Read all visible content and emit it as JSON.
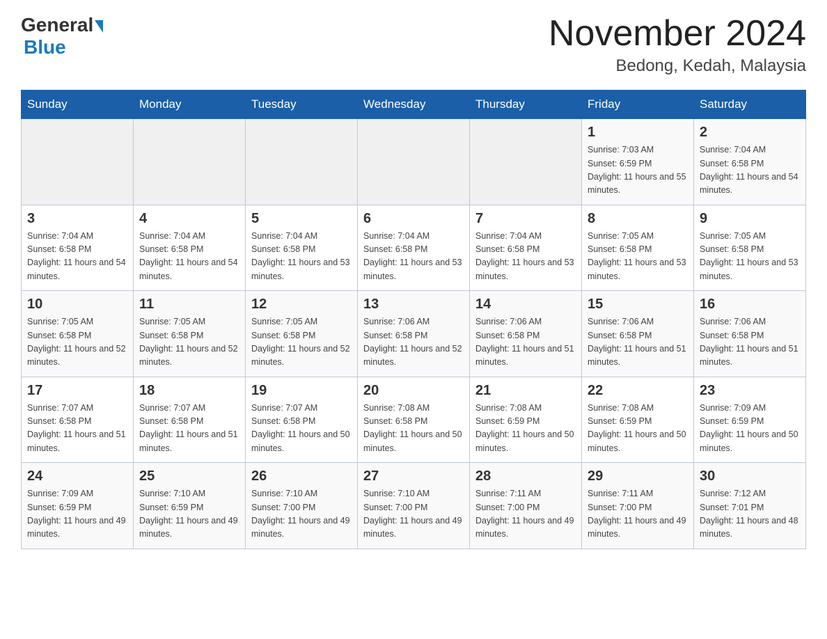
{
  "logo": {
    "general": "General",
    "blue": "Blue"
  },
  "header": {
    "month": "November 2024",
    "location": "Bedong, Kedah, Malaysia"
  },
  "days_of_week": [
    "Sunday",
    "Monday",
    "Tuesday",
    "Wednesday",
    "Thursday",
    "Friday",
    "Saturday"
  ],
  "weeks": [
    [
      {
        "day": "",
        "info": ""
      },
      {
        "day": "",
        "info": ""
      },
      {
        "day": "",
        "info": ""
      },
      {
        "day": "",
        "info": ""
      },
      {
        "day": "",
        "info": ""
      },
      {
        "day": "1",
        "info": "Sunrise: 7:03 AM\nSunset: 6:59 PM\nDaylight: 11 hours and 55 minutes."
      },
      {
        "day": "2",
        "info": "Sunrise: 7:04 AM\nSunset: 6:58 PM\nDaylight: 11 hours and 54 minutes."
      }
    ],
    [
      {
        "day": "3",
        "info": "Sunrise: 7:04 AM\nSunset: 6:58 PM\nDaylight: 11 hours and 54 minutes."
      },
      {
        "day": "4",
        "info": "Sunrise: 7:04 AM\nSunset: 6:58 PM\nDaylight: 11 hours and 54 minutes."
      },
      {
        "day": "5",
        "info": "Sunrise: 7:04 AM\nSunset: 6:58 PM\nDaylight: 11 hours and 53 minutes."
      },
      {
        "day": "6",
        "info": "Sunrise: 7:04 AM\nSunset: 6:58 PM\nDaylight: 11 hours and 53 minutes."
      },
      {
        "day": "7",
        "info": "Sunrise: 7:04 AM\nSunset: 6:58 PM\nDaylight: 11 hours and 53 minutes."
      },
      {
        "day": "8",
        "info": "Sunrise: 7:05 AM\nSunset: 6:58 PM\nDaylight: 11 hours and 53 minutes."
      },
      {
        "day": "9",
        "info": "Sunrise: 7:05 AM\nSunset: 6:58 PM\nDaylight: 11 hours and 53 minutes."
      }
    ],
    [
      {
        "day": "10",
        "info": "Sunrise: 7:05 AM\nSunset: 6:58 PM\nDaylight: 11 hours and 52 minutes."
      },
      {
        "day": "11",
        "info": "Sunrise: 7:05 AM\nSunset: 6:58 PM\nDaylight: 11 hours and 52 minutes."
      },
      {
        "day": "12",
        "info": "Sunrise: 7:05 AM\nSunset: 6:58 PM\nDaylight: 11 hours and 52 minutes."
      },
      {
        "day": "13",
        "info": "Sunrise: 7:06 AM\nSunset: 6:58 PM\nDaylight: 11 hours and 52 minutes."
      },
      {
        "day": "14",
        "info": "Sunrise: 7:06 AM\nSunset: 6:58 PM\nDaylight: 11 hours and 51 minutes."
      },
      {
        "day": "15",
        "info": "Sunrise: 7:06 AM\nSunset: 6:58 PM\nDaylight: 11 hours and 51 minutes."
      },
      {
        "day": "16",
        "info": "Sunrise: 7:06 AM\nSunset: 6:58 PM\nDaylight: 11 hours and 51 minutes."
      }
    ],
    [
      {
        "day": "17",
        "info": "Sunrise: 7:07 AM\nSunset: 6:58 PM\nDaylight: 11 hours and 51 minutes."
      },
      {
        "day": "18",
        "info": "Sunrise: 7:07 AM\nSunset: 6:58 PM\nDaylight: 11 hours and 51 minutes."
      },
      {
        "day": "19",
        "info": "Sunrise: 7:07 AM\nSunset: 6:58 PM\nDaylight: 11 hours and 50 minutes."
      },
      {
        "day": "20",
        "info": "Sunrise: 7:08 AM\nSunset: 6:58 PM\nDaylight: 11 hours and 50 minutes."
      },
      {
        "day": "21",
        "info": "Sunrise: 7:08 AM\nSunset: 6:59 PM\nDaylight: 11 hours and 50 minutes."
      },
      {
        "day": "22",
        "info": "Sunrise: 7:08 AM\nSunset: 6:59 PM\nDaylight: 11 hours and 50 minutes."
      },
      {
        "day": "23",
        "info": "Sunrise: 7:09 AM\nSunset: 6:59 PM\nDaylight: 11 hours and 50 minutes."
      }
    ],
    [
      {
        "day": "24",
        "info": "Sunrise: 7:09 AM\nSunset: 6:59 PM\nDaylight: 11 hours and 49 minutes."
      },
      {
        "day": "25",
        "info": "Sunrise: 7:10 AM\nSunset: 6:59 PM\nDaylight: 11 hours and 49 minutes."
      },
      {
        "day": "26",
        "info": "Sunrise: 7:10 AM\nSunset: 7:00 PM\nDaylight: 11 hours and 49 minutes."
      },
      {
        "day": "27",
        "info": "Sunrise: 7:10 AM\nSunset: 7:00 PM\nDaylight: 11 hours and 49 minutes."
      },
      {
        "day": "28",
        "info": "Sunrise: 7:11 AM\nSunset: 7:00 PM\nDaylight: 11 hours and 49 minutes."
      },
      {
        "day": "29",
        "info": "Sunrise: 7:11 AM\nSunset: 7:00 PM\nDaylight: 11 hours and 49 minutes."
      },
      {
        "day": "30",
        "info": "Sunrise: 7:12 AM\nSunset: 7:01 PM\nDaylight: 11 hours and 48 minutes."
      }
    ]
  ]
}
